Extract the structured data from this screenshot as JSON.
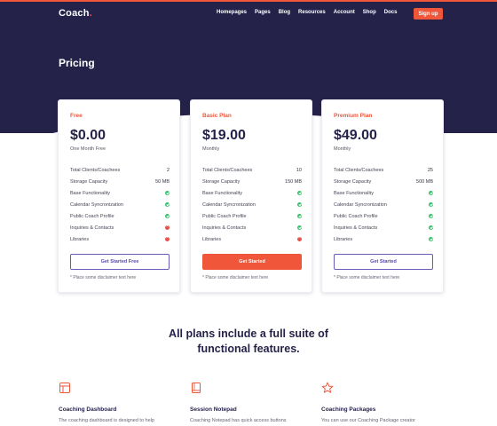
{
  "brand": {
    "logo": "Coach",
    "logo_dot": ".",
    "accent": "#f0563a",
    "dark": "#25224a"
  },
  "nav": {
    "links": [
      "Homepages",
      "Pages",
      "Blog",
      "Resources",
      "Account",
      "Shop",
      "Docs"
    ],
    "signup": "Sign up"
  },
  "page_title": "Pricing",
  "plans": [
    {
      "name": "Free",
      "price": "$0.00",
      "period": "One Month Free",
      "features": [
        {
          "label": "Total Clients/Coachees",
          "value": "2"
        },
        {
          "label": "Storage Capacity",
          "value": "50 MB"
        },
        {
          "label": "Base Functionality",
          "icon": "check-icon"
        },
        {
          "label": "Calendar Syncronization",
          "icon": "check-icon"
        },
        {
          "label": "Public Coach Profile",
          "icon": "check-icon"
        },
        {
          "label": "Inquiries & Contacts",
          "icon": "cross-icon"
        },
        {
          "label": "Libraries",
          "icon": "cross-icon"
        }
      ],
      "button": "Get Started Free",
      "disclaimer": "* Place some disclaimer text here"
    },
    {
      "name": "Basic Plan",
      "price": "$19.00",
      "period": "Monthly",
      "features": [
        {
          "label": "Total Clients/Coachees",
          "value": "10"
        },
        {
          "label": "Storage Capacity",
          "value": "150 MB"
        },
        {
          "label": "Base Functionality",
          "icon": "check-icon"
        },
        {
          "label": "Calendar Syncronization",
          "icon": "check-icon"
        },
        {
          "label": "Public Coach Profile",
          "icon": "check-icon"
        },
        {
          "label": "Inquiries & Contacts",
          "icon": "check-icon"
        },
        {
          "label": "Libraries",
          "icon": "cross-icon"
        }
      ],
      "button": "Get Started",
      "disclaimer": "* Place some disclaimer text here"
    },
    {
      "name": "Premium Plan",
      "price": "$49.00",
      "period": "Monthly",
      "features": [
        {
          "label": "Total Clients/Coachees",
          "value": "25"
        },
        {
          "label": "Storage Capacity",
          "value": "500 MB"
        },
        {
          "label": "Base Functionality",
          "icon": "check-icon"
        },
        {
          "label": "Calendar Syncronization",
          "icon": "check-icon"
        },
        {
          "label": "Public Coach Profile",
          "icon": "check-icon"
        },
        {
          "label": "Inquiries & Contacts",
          "icon": "check-icon"
        },
        {
          "label": "Libraries",
          "icon": "check-icon"
        }
      ],
      "button": "Get Started",
      "disclaimer": "* Place some disclaimer text here"
    }
  ],
  "features_section": {
    "title_line1": "All plans include a full suite of",
    "title_line2": "functional features.",
    "items": [
      {
        "icon": "layout-icon",
        "title": "Coaching Dashboard",
        "desc": "The coaching dashboard is designed to help"
      },
      {
        "icon": "book-icon",
        "title": "Session Notepad",
        "desc": "Coaching Notepad has quick access buttons"
      },
      {
        "icon": "star-icon",
        "title": "Coaching Packages",
        "desc": "You can use our Coaching Package creator"
      }
    ]
  }
}
